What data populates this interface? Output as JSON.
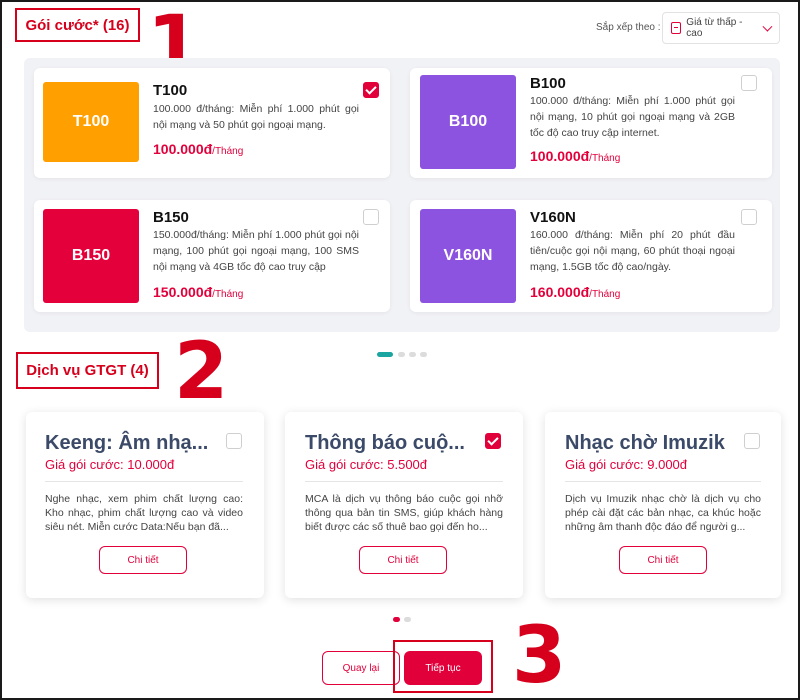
{
  "annotations": {
    "step1": "1",
    "step2": "2",
    "step3": "3"
  },
  "packages_section": {
    "title": "Gói cước* (16)",
    "sort_label": "Sắp xếp theo :",
    "sort_value": "Giá từ thấp - cao"
  },
  "packages": [
    {
      "tile": "T100",
      "tile_color": "#ff9f00",
      "name": "T100",
      "desc": "100.000 đ/tháng: Miễn phí 1.000 phút gọi nội mạng và 50 phút gọi ngoại mạng.",
      "price": "100.000đ",
      "unit": "/Tháng",
      "checked": true
    },
    {
      "tile": "B100",
      "tile_color": "#8c52e0",
      "name": "B100",
      "desc": "100.000 đ/tháng: Miễn phí 1.000 phút gọi nội mạng, 10 phút gọi ngoại mạng và 2GB tốc độ cao truy cập internet.",
      "price": "100.000đ",
      "unit": "/Tháng",
      "checked": false
    },
    {
      "tile": "B150",
      "tile_color": "#e4003b",
      "name": "B150",
      "desc": "150.000đ/tháng: Miễn phí 1.000 phút gọi nội mạng, 100 phút gọi ngoại mạng, 100 SMS nội mạng và 4GB tốc độ cao truy cập",
      "price": "150.000đ",
      "unit": "/Tháng",
      "checked": false
    },
    {
      "tile": "V160N",
      "tile_color": "#8c52e0",
      "name": "V160N",
      "desc": "160.000 đ/tháng: Miễn phí 20 phút đầu tiên/cuộc gọi nội mạng, 60 phút thoại ngoại mạng, 1.5GB tốc độ cao/ngày.",
      "price": "160.000đ",
      "unit": "/Tháng",
      "checked": false
    }
  ],
  "services_section": {
    "title": "Dịch vụ GTGT (4)"
  },
  "services": [
    {
      "title": "Keeng: Âm nhạ...",
      "price": "Giá gói cước: 10.000đ",
      "desc": "Nghe nhạc, xem phim chất lượng cao: Kho nhạc, phim chất lượng cao và video siêu nét. Miễn cước Data:Nếu bạn đã...",
      "button": "Chi tiết",
      "checked": false
    },
    {
      "title": "Thông báo cuộ...",
      "price": "Giá gói cước: 5.500đ",
      "desc": "MCA là dịch vụ thông báo cuộc gọi nhỡ thông qua bản tin SMS, giúp khách hàng biết được các số thuê bao gọi đến ho...",
      "button": "Chi tiết",
      "checked": true
    },
    {
      "title": "Nhạc chờ Imuzik",
      "price": "Giá gói cước: 9.000đ",
      "desc": "Dịch vụ Imuzik nhạc chờ là dịch vụ cho phép cài đặt các bản nhạc, ca khúc hoặc những âm thanh độc đáo để người g...",
      "button": "Chi tiết",
      "checked": false
    }
  ],
  "actions": {
    "back": "Quay lại",
    "next": "Tiếp tục"
  },
  "colors": {
    "accent": "#e2003b",
    "annotation": "#d6001c",
    "carousel_active": "#1aa5a0"
  }
}
